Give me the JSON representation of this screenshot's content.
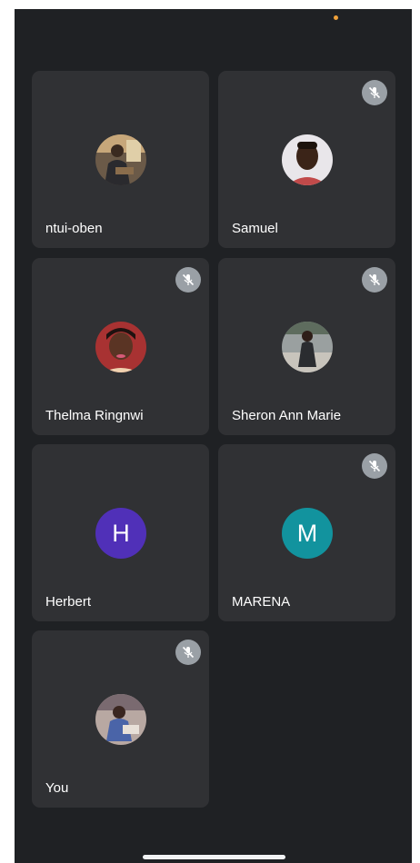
{
  "participants": [
    {
      "name": "ntui-oben",
      "avatar": "photo",
      "muted": false
    },
    {
      "name": "Samuel",
      "avatar": "photo",
      "muted": true
    },
    {
      "name": "Thelma Ringnwi",
      "avatar": "photo",
      "muted": true
    },
    {
      "name": "Sheron Ann Marie",
      "avatar": "photo",
      "muted": true
    },
    {
      "name": "Herbert",
      "avatar": "letter",
      "initial": "H",
      "avatar_color": "#5030b8",
      "muted": false
    },
    {
      "name": "MARENA",
      "avatar": "letter",
      "initial": "M",
      "avatar_color": "#12939e",
      "muted": true
    },
    {
      "name": "You",
      "avatar": "photo",
      "muted": true
    }
  ],
  "icons": {
    "mute": "mic-off-icon"
  },
  "colors": {
    "background": "#1f2124",
    "tile": "#303134",
    "mute_badge": "#9aa0a6",
    "status_dot": "#f0a13a"
  }
}
